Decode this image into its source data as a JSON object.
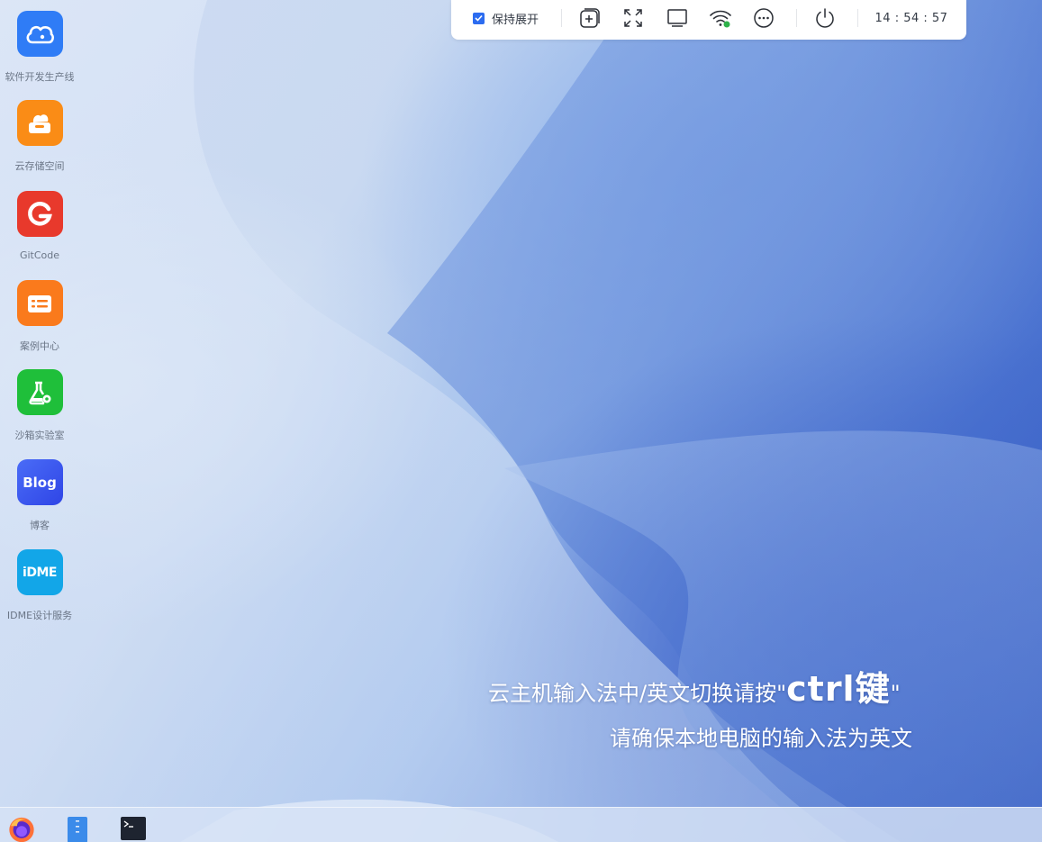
{
  "desktop_icons": [
    {
      "label": "软件开发生产线",
      "icon": "cloud-devline-icon",
      "color": "#2f7cf6"
    },
    {
      "label": "云存储空间",
      "icon": "cloud-storage-icon",
      "color": "#fa8c16"
    },
    {
      "label": "GitCode",
      "icon": "gitcode-icon",
      "color": "#e8392c"
    },
    {
      "label": "案例中心",
      "icon": "case-center-icon",
      "color": "#fa7a1c"
    },
    {
      "label": "沙箱实验室",
      "icon": "sandbox-lab-icon",
      "color": "#1fbf3a"
    },
    {
      "label": "博客",
      "icon": "blog-icon",
      "color": "#3b5cf6",
      "glyph": "Blog"
    },
    {
      "label": "IDME设计服务",
      "icon": "idme-icon",
      "color": "#12a6e8",
      "glyph": "iDME"
    }
  ],
  "toolbar": {
    "keep_expanded_label": "保持展开",
    "keep_expanded_checked": true,
    "clock": "14 : 54 : 57",
    "buttons": [
      "new-window-icon",
      "fullscreen-icon",
      "display-icon",
      "wifi-icon",
      "more-icon",
      "power-icon"
    ],
    "accent_color": "#2c6cf0",
    "wifi_status_color": "#2fb14a"
  },
  "notice": {
    "line1_prefix": "云主机输入法中/英文切换请按\"",
    "line1_key": "ctrl键",
    "line1_suffix": "\"",
    "line2": "请确保本地电脑的输入法为英文"
  },
  "taskbar": {
    "apps": [
      "firefox-icon",
      "file-manager-icon",
      "terminal-icon"
    ]
  }
}
